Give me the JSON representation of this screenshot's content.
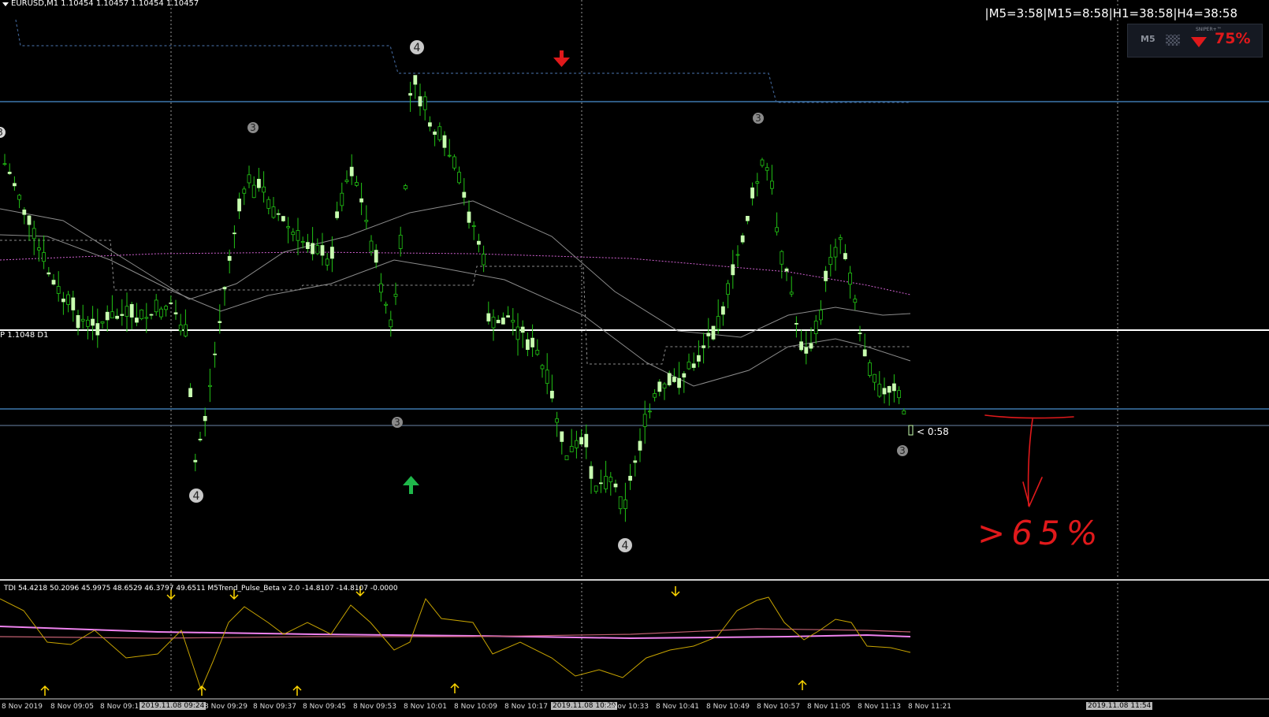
{
  "window": {
    "symbol_header": "EURUSD,M1  1.10454 1.10457 1.10454 1.10457",
    "timers": "|M5=3:58|M15=8:58|H1=38:58|H4=38:58"
  },
  "signal_widget": {
    "timeframe": "M5",
    "brand": "SNIPER+™",
    "direction_icon": "red-down-triangle",
    "percent": "75%"
  },
  "price_labels": {
    "pivot": "P 1.1048 D1",
    "bar_countdown": "< 0:58"
  },
  "markers": {
    "wave_labels": [
      "3",
      "3",
      "4",
      "3",
      "3",
      "4",
      "4",
      "3"
    ],
    "arrows": [
      "red-down-arrow",
      "green-up-arrow"
    ]
  },
  "annotation": {
    "handwritten_text": ">65%"
  },
  "indicator_panel": {
    "label": "TDI 54.4218 50.2096 45.9975 48.6529 46.3797 49.6511  M5Trend_Pulse_Beta v 2.0 -14.8107 -14.8107 -0.0000"
  },
  "time_axis": {
    "ticks": [
      "8 Nov 2019",
      "8 Nov 09:05",
      "8 Nov 09:13",
      "8 Nov 09:29",
      "8 Nov 09:37",
      "8 Nov 09:45",
      "8 Nov 09:53",
      "8 Nov 10:01",
      "8 Nov 10:09",
      "8 Nov 10:17",
      "8 Nov 10:33",
      "8 Nov 10:41",
      "8 Nov 10:49",
      "8 Nov 10:57",
      "8 Nov 11:05",
      "8 Nov 11:13",
      "8 Nov 11:21"
    ],
    "highlighted": [
      "2019.11.08 09:24",
      "2019.11.08 10:29",
      "2019.11.08 11:54"
    ]
  },
  "colors": {
    "background": "#000000",
    "bull_candle": "#c8ffb0",
    "wick": "#22c414",
    "pivot_line": "#ffffff",
    "level_line": "#4a8fd0",
    "tdi_fast": "#c8a400",
    "tdi_slow": "#ee82ee",
    "annotation": "#e0191b"
  }
}
